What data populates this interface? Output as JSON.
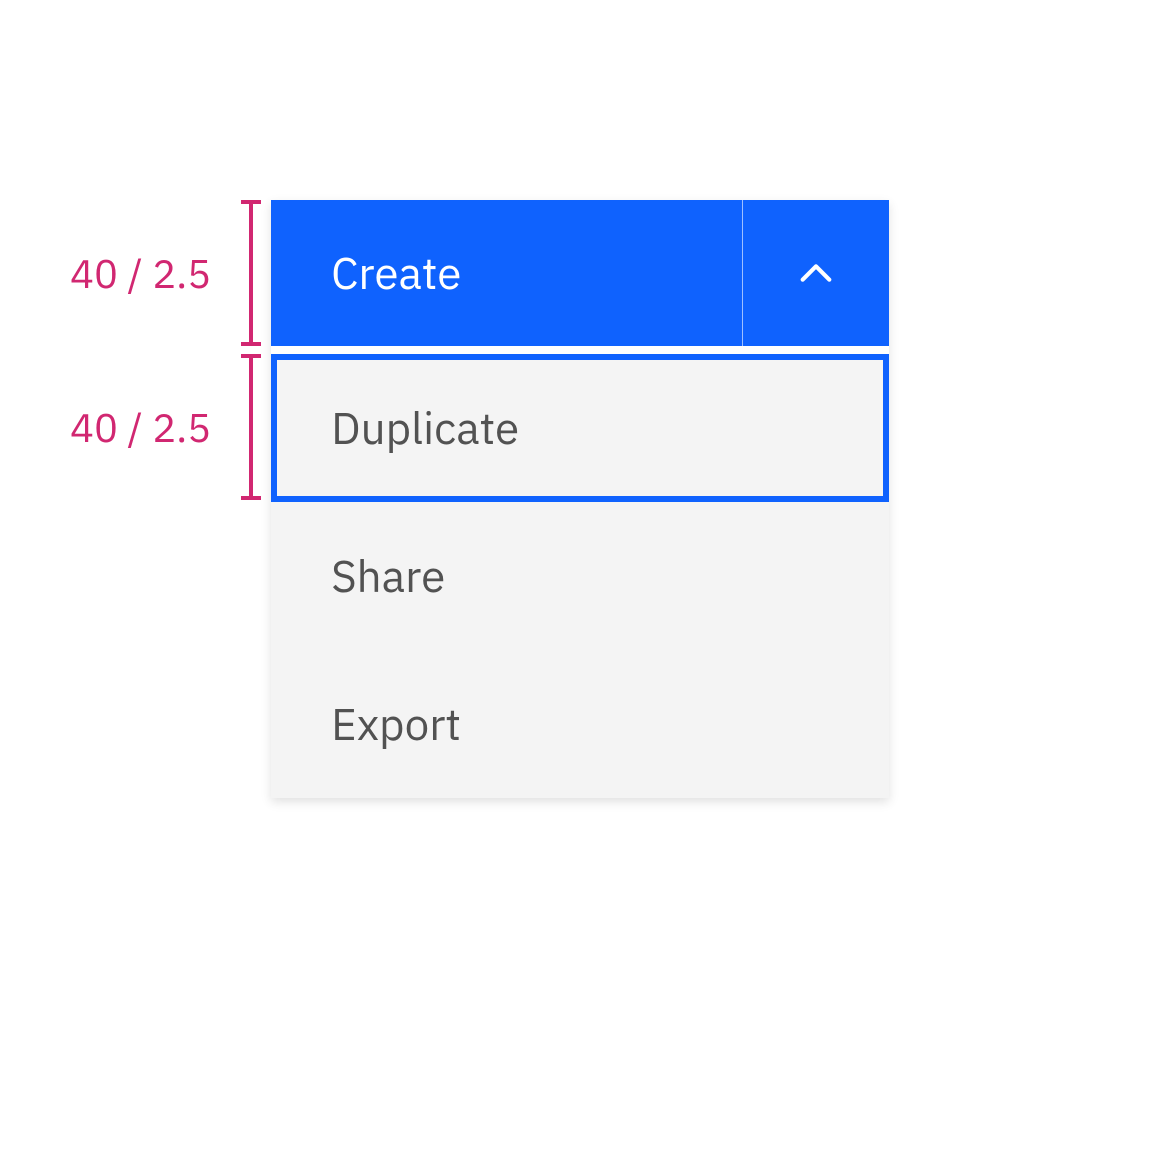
{
  "annotations": {
    "button_height": "40 / 2.5",
    "item_height": "40 / 2.5"
  },
  "split_button": {
    "primary_label": "Create"
  },
  "dropdown": {
    "items": [
      {
        "label": "Duplicate"
      },
      {
        "label": "Share"
      },
      {
        "label": "Export"
      }
    ]
  },
  "colors": {
    "primary": "#0f62fe",
    "annotation": "#d12771",
    "menu_bg": "#f4f4f4",
    "menu_text": "#525252"
  }
}
